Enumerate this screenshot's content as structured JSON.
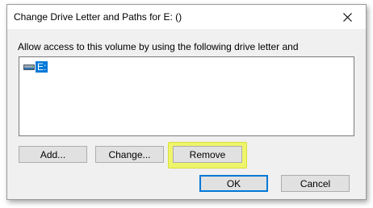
{
  "window": {
    "title": "Change Drive Letter and Paths for E: ()",
    "close_glyph": "✕"
  },
  "description": "Allow access to this volume by using the following drive letter and",
  "drive_list": {
    "items": [
      {
        "label": "E:",
        "icon": "drive-icon",
        "selected": true
      }
    ]
  },
  "buttons": {
    "add": "Add...",
    "change": "Change...",
    "remove": "Remove",
    "ok": "OK",
    "cancel": "Cancel"
  },
  "colors": {
    "selection": "#0078d7",
    "highlight": "#eff56a"
  }
}
